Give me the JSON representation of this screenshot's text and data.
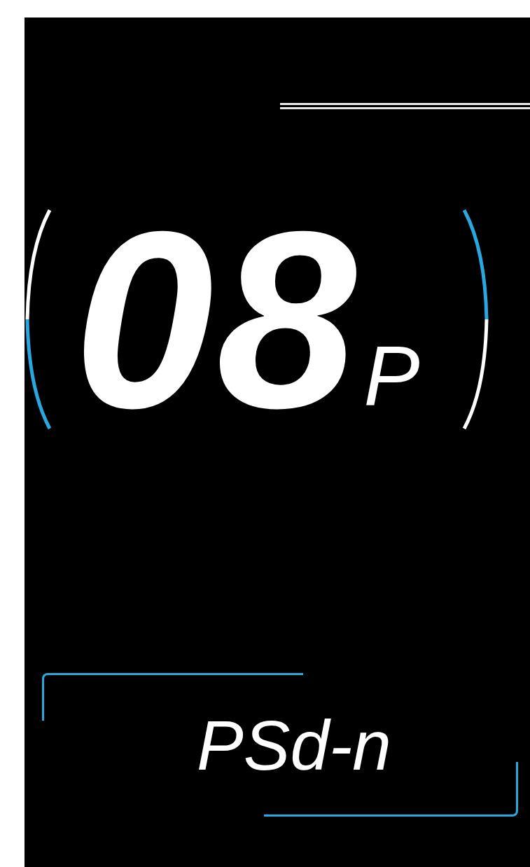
{
  "speed": {
    "value": "08",
    "unit": "P"
  },
  "mode": {
    "text": "PSd-n"
  }
}
